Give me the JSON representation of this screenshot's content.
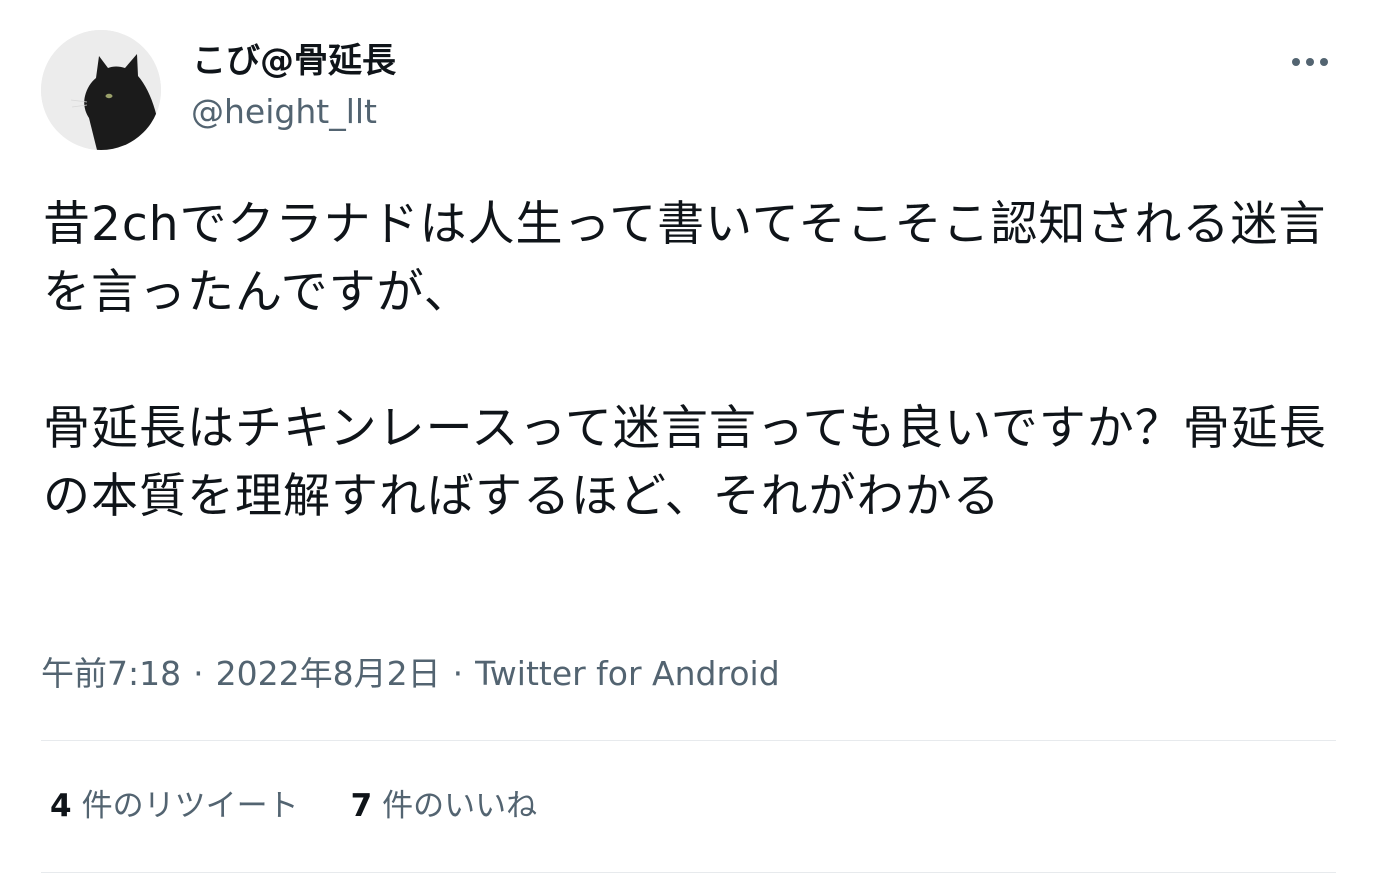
{
  "tweet": {
    "author": {
      "display_name": "こび@骨延長",
      "handle": "@height_llt"
    },
    "body": {
      "paragraph1": "昔2chでクラナドは人生って書いてそこそこ認知される迷言を言ったんですが、",
      "paragraph2": "骨延長はチキンレースって迷言言っても良いですか？骨延長の本質を理解すればするほど、それがわかる"
    },
    "meta": {
      "time": "午前7:18",
      "separator": "·",
      "date": "2022年8月2日",
      "source": "Twitter for Android"
    },
    "stats": {
      "retweets": {
        "count": "4",
        "label": "件のリツイート"
      },
      "likes": {
        "count": "7",
        "label": "件のいいね"
      }
    },
    "icons": {
      "more": "more-horizontal-icon",
      "avatar": "black-cat-avatar"
    },
    "colors": {
      "text": "#0f1419",
      "secondary_text": "#536471",
      "divider": "#e7eaed"
    }
  }
}
